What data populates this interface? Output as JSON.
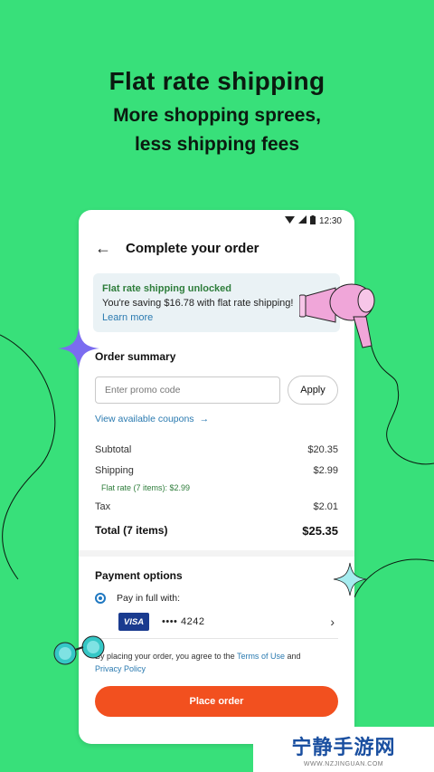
{
  "headline": {
    "title": "Flat rate shipping",
    "subtitle_line1": "More shopping sprees,",
    "subtitle_line2": "less shipping fees"
  },
  "status_bar": {
    "time": "12:30",
    "icons": [
      "wifi-icon",
      "signal-icon",
      "battery-icon"
    ]
  },
  "app_bar": {
    "title": "Complete your order",
    "back_icon": "arrow-left-icon"
  },
  "banner": {
    "title": "Flat rate shipping unlocked",
    "message": "You're saving $16.78 with flat rate shipping!",
    "link": "Learn more"
  },
  "order_summary": {
    "title": "Order summary",
    "promo_placeholder": "Enter promo code",
    "apply_label": "Apply",
    "coupons_link": "View available coupons",
    "rows": {
      "subtotal_label": "Subtotal",
      "subtotal_value": "$20.35",
      "shipping_label": "Shipping",
      "shipping_value": "$2.99",
      "flat_rate_note": "Flat rate (7 items): $2.99",
      "tax_label": "Tax",
      "tax_value": "$2.01",
      "total_label": "Total (7 items)",
      "total_value": "$25.35"
    }
  },
  "payment": {
    "title": "Payment options",
    "option_label": "Pay in full with:",
    "card_brand": "VISA",
    "card_masked": "•••• 4242"
  },
  "footer": {
    "terms_prefix": "By placing your order, you agree to the ",
    "terms_link": "Terms of Use",
    "terms_mid": " and",
    "privacy_link": "Privacy Policy",
    "place_order": "Place order"
  },
  "watermark": {
    "main": "宁静手游网",
    "sub": "WWW.NZJINGUAN.COM"
  },
  "colors": {
    "background": "#38e07a",
    "accent": "#f2501f",
    "link": "#2a7ab0",
    "success": "#2e7d3b"
  }
}
